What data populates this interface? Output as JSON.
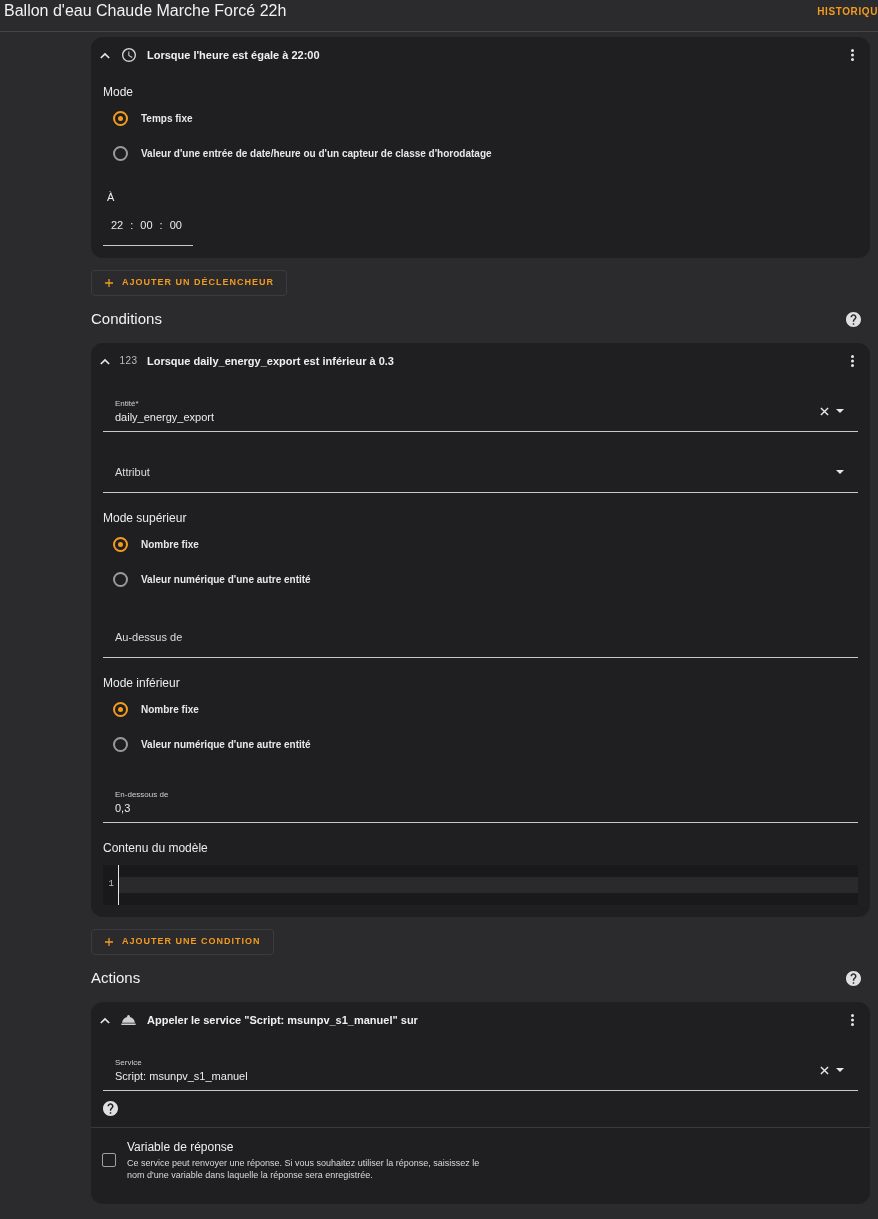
{
  "header": {
    "title": "Ballon d'eau Chaude Marche Forcé 22h",
    "action": "HISTORIQU"
  },
  "sections": [
    {
      "cards": [
        {
          "kind": "time",
          "expanded": true,
          "title": "Lorsque l'heure est égale à 22:00",
          "fields": [
            {
              "kind": "radio_group",
              "label": "Mode",
              "options": [
                {
                  "label": "Temps fixe",
                  "selected": true
                },
                {
                  "label": "Valeur d'une entrée de date/heure ou d'un capteur de classe d'horodatage",
                  "selected": false
                }
              ]
            },
            {
              "kind": "time",
              "label": "À",
              "parts": [
                "22",
                "00",
                "00"
              ],
              "separators": [
                ":",
                ":"
              ]
            }
          ]
        }
      ],
      "add_button": "AJOUTER UN DÉCLENCHEUR"
    },
    {
      "heading": "Conditions",
      "cards": [
        {
          "kind": "numeric_state",
          "icon_text": "123",
          "expanded": true,
          "title": "Lorsque daily_energy_export est inférieur à 0.3",
          "fields": [
            {
              "kind": "select",
              "label": "Entité*",
              "value": "daily_energy_export",
              "clearable": true
            },
            {
              "kind": "select",
              "label": "Attribut",
              "clearable": false
            },
            {
              "kind": "radio_group",
              "label": "Mode supérieur",
              "options": [
                {
                  "label": "Nombre fixe",
                  "selected": true
                },
                {
                  "label": "Valeur numérique d'une autre entité",
                  "selected": false
                }
              ]
            },
            {
              "kind": "text_field",
              "label": "Au-dessus de"
            },
            {
              "kind": "radio_group",
              "label": "Mode inférieur",
              "options": [
                {
                  "label": "Nombre fixe",
                  "selected": true
                },
                {
                  "label": "Valeur numérique d'une autre entité",
                  "selected": false
                }
              ]
            },
            {
              "kind": "text_field",
              "label": "En-dessous de",
              "value": "0,3"
            },
            {
              "kind": "code_editor",
              "label": "Contenu du modèle",
              "lines": [
                {
                  "number": "1",
                  "active": true
                }
              ]
            }
          ]
        }
      ],
      "add_button": "AJOUTER UNE CONDITION"
    },
    {
      "heading": "Actions",
      "cards": [
        {
          "kind": "service",
          "expanded": true,
          "title": "Appeler le service \"Script: msunpv_s1_manuel\" sur",
          "fields": [
            {
              "kind": "select",
              "label": "Service",
              "value": "Script: msunpv_s1_manuel",
              "clearable": true
            },
            {
              "kind": "help"
            },
            {
              "kind": "checkbox",
              "label": "Variable de réponse",
              "description": "Ce service peut renvoyer une réponse. Si vous souhaitez utiliser la réponse, saisissez le nom d'une variable dans laquelle la réponse sera enregistrée.",
              "checked": false
            }
          ]
        }
      ]
    }
  ]
}
